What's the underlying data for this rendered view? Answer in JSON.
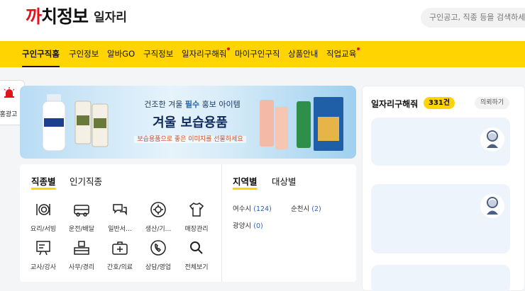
{
  "header": {
    "logo_part1": "까",
    "logo_part2": "치정보",
    "logo_sub": "일자리",
    "search_placeholder": "구인공고, 직종 등을 검색하세요"
  },
  "nav": {
    "items": [
      {
        "label": "구인구직홈",
        "active": true,
        "dot": false
      },
      {
        "label": "구인정보",
        "active": false,
        "dot": false
      },
      {
        "label": "알바GO",
        "active": false,
        "dot": false
      },
      {
        "label": "구직정보",
        "active": false,
        "dot": false
      },
      {
        "label": "일자리구해줘",
        "active": false,
        "dot": true
      },
      {
        "label": "마이구인구직",
        "active": false,
        "dot": false
      },
      {
        "label": "상품안내",
        "active": false,
        "dot": false
      },
      {
        "label": "직업교육",
        "active": false,
        "dot": true
      }
    ]
  },
  "float_ad": {
    "label": "홍광고",
    "icon": "siren-icon",
    "icon_color": "#e4121b"
  },
  "banner": {
    "line1_pre": "건조한 겨울",
    "line1_hl": "필수",
    "line1_post": "홍보 아이템",
    "headline": "겨울 보습용품",
    "subline": "보습용품으로 좋은 이미지를 선물하세요"
  },
  "categories": {
    "tabs": [
      {
        "label": "직종별",
        "active": true
      },
      {
        "label": "인기직종",
        "active": false
      }
    ],
    "items": [
      {
        "label": "요리/서빙",
        "icon": "dish-icon"
      },
      {
        "label": "운전/배달",
        "icon": "truck-icon"
      },
      {
        "label": "일반서...",
        "icon": "chat-icon"
      },
      {
        "label": "생산/기...",
        "icon": "gear-icon"
      },
      {
        "label": "매장관리",
        "icon": "shirt-icon"
      },
      {
        "label": "교사/강사",
        "icon": "board-icon"
      },
      {
        "label": "사무/경리",
        "icon": "desk-icon"
      },
      {
        "label": "간호/의료",
        "icon": "medical-kit-icon"
      },
      {
        "label": "상담/영업",
        "icon": "phone-icon"
      },
      {
        "label": "전체보기",
        "icon": "search-icon"
      }
    ]
  },
  "regions": {
    "tabs": [
      {
        "label": "지역별",
        "active": true
      },
      {
        "label": "대상별",
        "active": false
      }
    ],
    "items": [
      {
        "name": "여수시",
        "count": "(124)"
      },
      {
        "name": "순천시",
        "count": "(2)"
      },
      {
        "name": "광양시",
        "count": "(0)"
      }
    ]
  },
  "right_panel": {
    "title": "일자리구해줘",
    "badge": "331건",
    "button": "의뢰하기"
  },
  "colors": {
    "brand_yellow": "#ffd400",
    "brand_red": "#e4121b",
    "link_blue": "#2a62c9"
  }
}
